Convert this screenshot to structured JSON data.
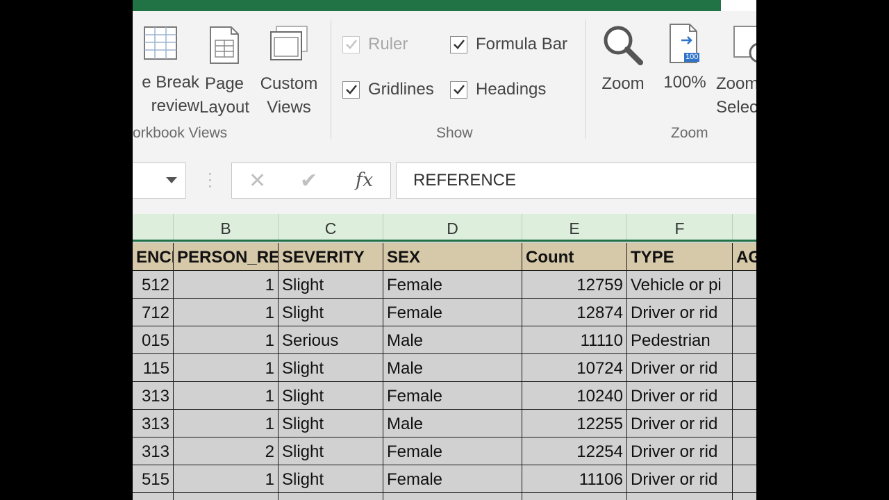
{
  "ribbon": {
    "workbook_views": {
      "group_label": "orkbook Views",
      "buttons": [
        {
          "name": "page-break-preview-button",
          "icon": "page-break-icon",
          "line1": "e Break",
          "line2": "review"
        },
        {
          "name": "page-layout-button",
          "icon": "page-layout-icon",
          "line1": "Page",
          "line2": "Layout"
        },
        {
          "name": "custom-views-button",
          "icon": "custom-views-icon",
          "line1": "Custom",
          "line2": "Views"
        }
      ]
    },
    "show": {
      "group_label": "Show",
      "ruler": {
        "label": "Ruler",
        "checked": true,
        "disabled": true
      },
      "formula_bar": {
        "label": "Formula Bar",
        "checked": true
      },
      "gridlines": {
        "label": "Gridlines",
        "checked": true
      },
      "headings": {
        "label": "Headings",
        "checked": true
      }
    },
    "zoom": {
      "group_label": "Zoom",
      "zoom_label": "Zoom",
      "hundred_label": "100%",
      "hundred_badge": "100",
      "zoom_selection_line1": "Zoom",
      "zoom_selection_line2": "Selec"
    }
  },
  "formula_bar": {
    "name_box_value": "",
    "cancel_symbol": "✕",
    "enter_symbol": "✔",
    "fx_label": "fx",
    "content": "REFERENCE"
  },
  "sheet": {
    "column_letters": [
      "",
      "B",
      "C",
      "D",
      "E",
      "F",
      ""
    ],
    "header_row": [
      "ENCE",
      "PERSON_RE",
      "SEVERITY",
      "SEX",
      "Count",
      "TYPE",
      "AG"
    ],
    "rows": [
      [
        "512",
        "1",
        "Slight",
        "Female",
        "12759",
        "Vehicle or pi",
        ""
      ],
      [
        "712",
        "1",
        "Slight",
        "Female",
        "12874",
        "Driver or rid",
        ""
      ],
      [
        "015",
        "1",
        "Serious",
        "Male",
        "11110",
        "Pedestrian",
        ""
      ],
      [
        "115",
        "1",
        "Slight",
        "Male",
        "10724",
        "Driver or rid",
        ""
      ],
      [
        "313",
        "1",
        "Slight",
        "Female",
        "10240",
        "Driver or rid",
        ""
      ],
      [
        "313",
        "1",
        "Slight",
        "Male",
        "12255",
        "Driver or rid",
        ""
      ],
      [
        "313",
        "2",
        "Slight",
        "Female",
        "12254",
        "Driver or rid",
        ""
      ],
      [
        "515",
        "1",
        "Slight",
        "Female",
        "11106",
        "Driver or rid",
        ""
      ],
      [
        "",
        "",
        "",
        "",
        "",
        "",
        ""
      ]
    ]
  },
  "colors": {
    "title_bar": "#217346",
    "header_fill": "#d6c9aa",
    "cell_fill": "#d1d1d1",
    "column_header_fill": "#ddeedd"
  }
}
